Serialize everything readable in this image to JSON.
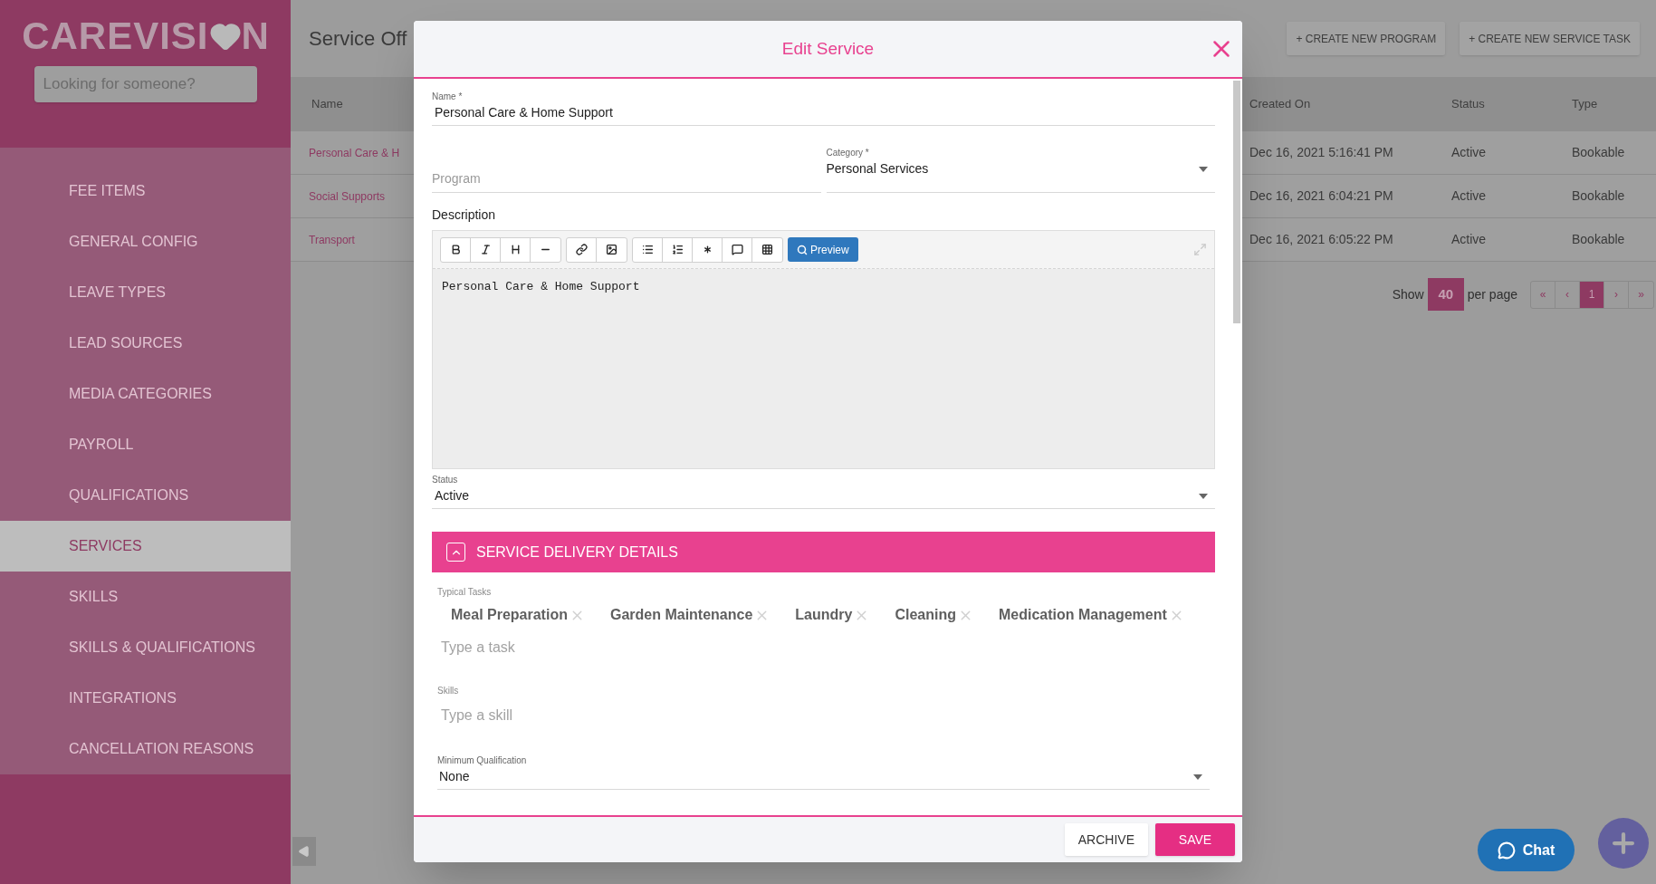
{
  "sidebar": {
    "logo": {
      "left": "CAREVISI",
      "right": "N"
    },
    "search": {
      "placeholder": "Looking for someone?"
    },
    "items": [
      {
        "label": "FEE ITEMS",
        "selected": false
      },
      {
        "label": "GENERAL CONFIG",
        "selected": false
      },
      {
        "label": "LEAVE TYPES",
        "selected": false
      },
      {
        "label": "LEAD SOURCES",
        "selected": false
      },
      {
        "label": "MEDIA CATEGORIES",
        "selected": false
      },
      {
        "label": "PAYROLL",
        "selected": false
      },
      {
        "label": "QUALIFICATIONS",
        "selected": false
      },
      {
        "label": "SERVICES",
        "selected": true
      },
      {
        "label": "SKILLS",
        "selected": false
      },
      {
        "label": "SKILLS & QUALIFICATIONS",
        "selected": false
      },
      {
        "label": "INTEGRATIONS",
        "selected": false
      },
      {
        "label": "CANCELLATION REASONS",
        "selected": false
      }
    ]
  },
  "page": {
    "title": "Service Off",
    "buttons": [
      "+ CREATE NEW PROGRAM",
      "+ CREATE NEW SERVICE TASK"
    ],
    "table": {
      "columns": [
        "Name",
        "Created On",
        "Status",
        "Type"
      ],
      "rows": [
        {
          "name": "Personal Care & H",
          "created_on": "Dec 16, 2021 5:16:41 PM",
          "status": "Active",
          "type": "Bookable"
        },
        {
          "name": "Social Supports",
          "created_on": "Dec 16, 2021 6:04:21 PM",
          "status": "Active",
          "type": "Bookable"
        },
        {
          "name": "Transport",
          "created_on": "Dec 16, 2021 6:05:22 PM",
          "status": "Active",
          "type": "Bookable"
        }
      ]
    },
    "pagination": {
      "show_label": "Show",
      "per_page": "40",
      "per_page_label": "per page",
      "pages": [
        {
          "label": "«",
          "selected": false
        },
        {
          "label": "‹",
          "selected": false
        },
        {
          "label": "1",
          "selected": true
        },
        {
          "label": "›",
          "selected": false
        },
        {
          "label": "»",
          "selected": false
        }
      ]
    }
  },
  "modal": {
    "title": "Edit Service",
    "name": {
      "label": "Name *",
      "value": "Personal Care & Home Support"
    },
    "program": {
      "placeholder": "Program"
    },
    "category": {
      "label": "Category *",
      "value": "Personal Services"
    },
    "description": {
      "label": "Description",
      "preview": "Preview",
      "content": "Personal Care & Home Support"
    },
    "status": {
      "label": "Status",
      "value": "Active"
    },
    "section": {
      "title": "SERVICE DELIVERY DETAILS",
      "expanded": true
    },
    "typical_tasks": {
      "label": "Typical Tasks",
      "tags": [
        "Meal Preparation",
        "Garden Maintenance",
        "Laundry",
        "Cleaning",
        "Medication Management"
      ],
      "placeholder": "Type a task"
    },
    "skills": {
      "label": "Skills",
      "placeholder": "Type a skill"
    },
    "minimum_qualification": {
      "label": "Minimum Qualification",
      "value": "None"
    },
    "buttons": [
      {
        "label": "ARCHIVE",
        "kind": "secondary"
      },
      {
        "label": "SAVE",
        "kind": "primary"
      }
    ]
  },
  "chat": {
    "label": "Chat"
  }
}
